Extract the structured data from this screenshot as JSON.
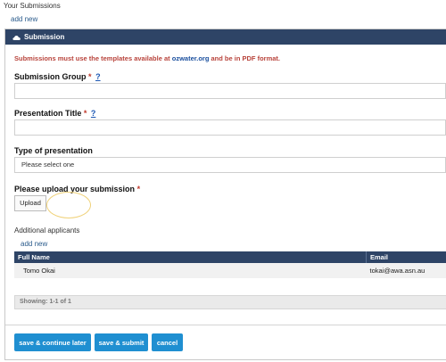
{
  "page": {
    "title": "Your Submissions",
    "add_new": "add new"
  },
  "panel": {
    "header_icon": "cloud-icon",
    "header_title": "Submission",
    "notice_before": "Submissions must use the templates available at ",
    "notice_link": "ozwater.org",
    "notice_after": " and be in PDF format."
  },
  "form": {
    "submission_group": {
      "label": "Submission Group",
      "required": "*",
      "help": "?",
      "value": ""
    },
    "presentation_title": {
      "label": "Presentation Title",
      "required": "*",
      "help": "?",
      "value": ""
    },
    "type_of_presentation": {
      "label": "Type of presentation",
      "selected": "Please select one"
    },
    "upload": {
      "label": "Please upload your submission",
      "required": "*",
      "button": "Upload"
    }
  },
  "applicants": {
    "title": "Additional applicants",
    "add_new": "add new",
    "columns": [
      "Full Name",
      "Email"
    ],
    "rows": [
      {
        "name": "Tomo Okai",
        "email": "tokai@awa.asn.au"
      }
    ],
    "pager": "Showing: 1-1 of 1"
  },
  "buttons": {
    "save_continue": "save & continue later",
    "save_submit": "save & submit",
    "cancel": "cancel"
  },
  "colors": {
    "header_bg": "#2e4466",
    "button_bg": "#1f8fd1",
    "notice": "#b8433b",
    "link": "#1a4f9e"
  }
}
